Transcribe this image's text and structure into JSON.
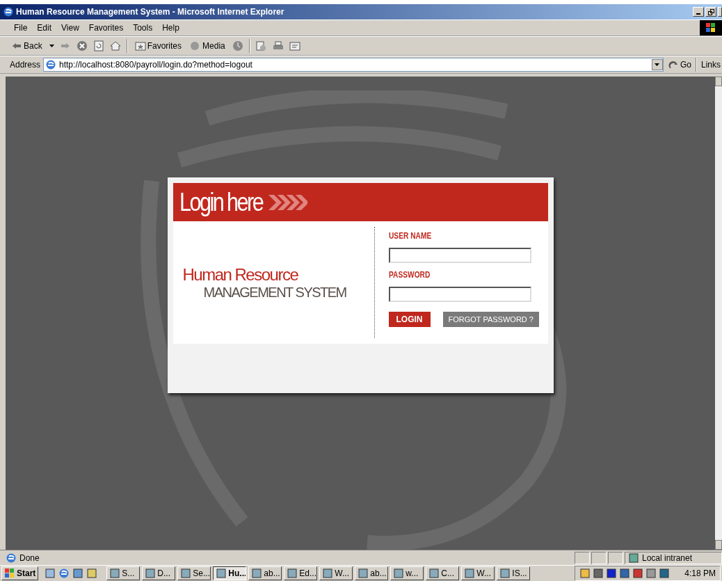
{
  "window": {
    "title": "Human Resource Management System - Microsoft Internet Explorer"
  },
  "menu": [
    "File",
    "Edit",
    "View",
    "Favorites",
    "Tools",
    "Help"
  ],
  "toolbar": {
    "back": "Back",
    "favorites": "Favorites",
    "media": "Media"
  },
  "address": {
    "label": "Address",
    "url": "http://localhost:8080/payroll/login.do?method=logout",
    "go": "Go",
    "links": "Links"
  },
  "login": {
    "header": "Login here",
    "brand_line_1": "Human Resource",
    "brand_line_2": "MANAGEMENT SYSTEM",
    "username_label": "USER NAME",
    "password_label": "PASSWORD",
    "login_button": "LOGIN",
    "forgot_button": "FORGOT PASSWORD ?"
  },
  "status_bar": {
    "text": "Done",
    "zone": "Local intranet"
  },
  "taskbar": {
    "start": "Start",
    "tasks": [
      {
        "label": "S...",
        "selected": false
      },
      {
        "label": "D...",
        "selected": false
      },
      {
        "label": "Se...",
        "selected": false
      },
      {
        "label": "Hu...",
        "selected": true
      },
      {
        "label": "ab...",
        "selected": false
      },
      {
        "label": "Ed...",
        "selected": false
      },
      {
        "label": "W...",
        "selected": false
      },
      {
        "label": "ab...",
        "selected": false
      },
      {
        "label": "w...",
        "selected": false
      },
      {
        "label": "C...",
        "selected": false
      },
      {
        "label": "W...",
        "selected": false
      },
      {
        "label": "IS...",
        "selected": false
      }
    ],
    "clock": "4:18 PM"
  }
}
